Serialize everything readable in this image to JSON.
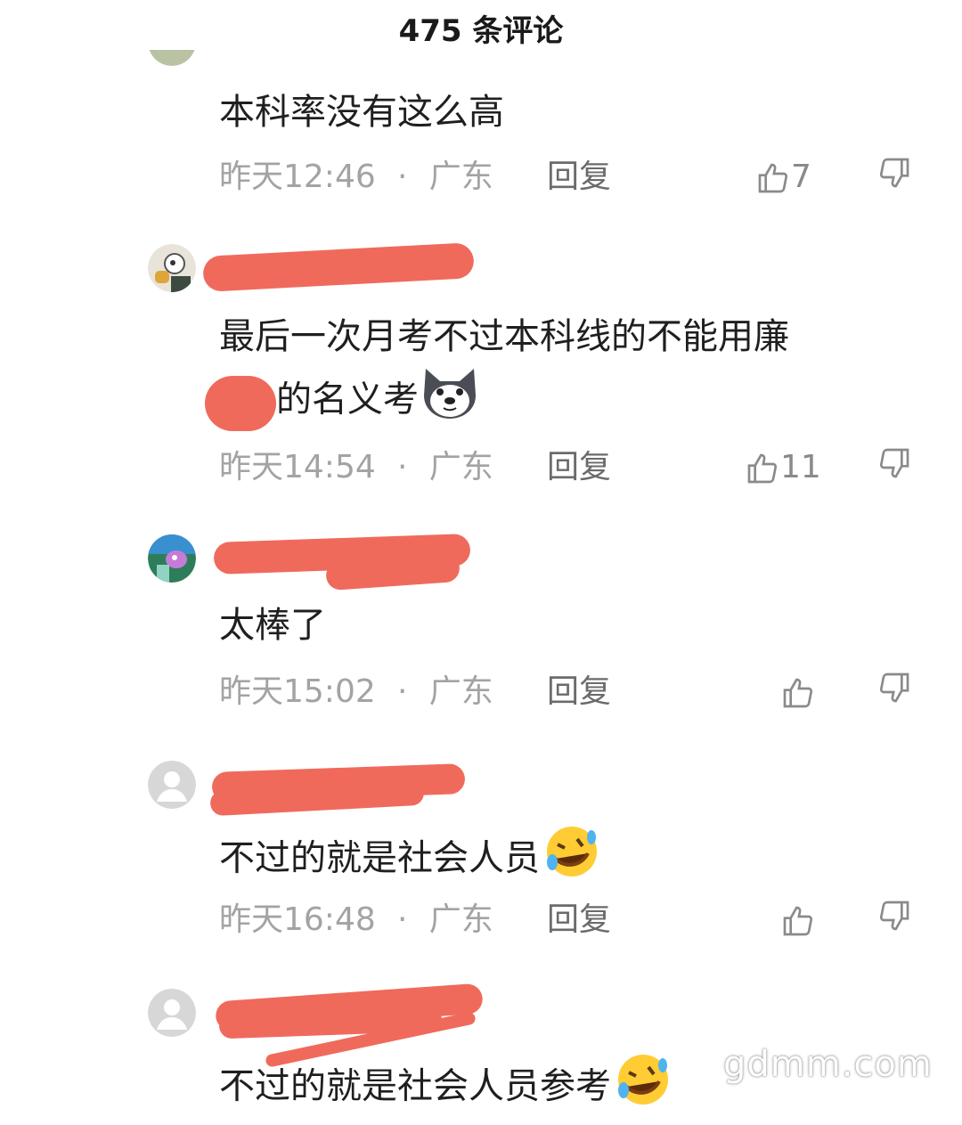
{
  "header": {
    "title": "475 条评论"
  },
  "comments": [
    {
      "text": "本科率没有这么高",
      "time": "昨天12:46",
      "location": "广东",
      "reply": "回复",
      "likes": "7"
    },
    {
      "text_line1": "最后一次月考不过本科线的不能用廉",
      "text_line2": "的名义考",
      "emoji": "dog-face-emoji",
      "time": "昨天14:54",
      "location": "广东",
      "reply": "回复",
      "likes": "11"
    },
    {
      "text": "太棒了",
      "time": "昨天15:02",
      "location": "广东",
      "reply": "回复",
      "likes": ""
    },
    {
      "text": "不过的就是社会人员",
      "emoji": "rolling-laughing-emoji",
      "time": "昨天16:48",
      "location": "广东",
      "reply": "回复",
      "likes": ""
    },
    {
      "text": "不过的就是社会人员参考",
      "emoji": "rolling-laughing-emoji"
    }
  ],
  "separator": "·",
  "watermark": "gdmm.com",
  "colors": {
    "redaction": "#f06a5c",
    "meta_text": "#a3a3a3",
    "body_text": "#1f1f1f"
  }
}
